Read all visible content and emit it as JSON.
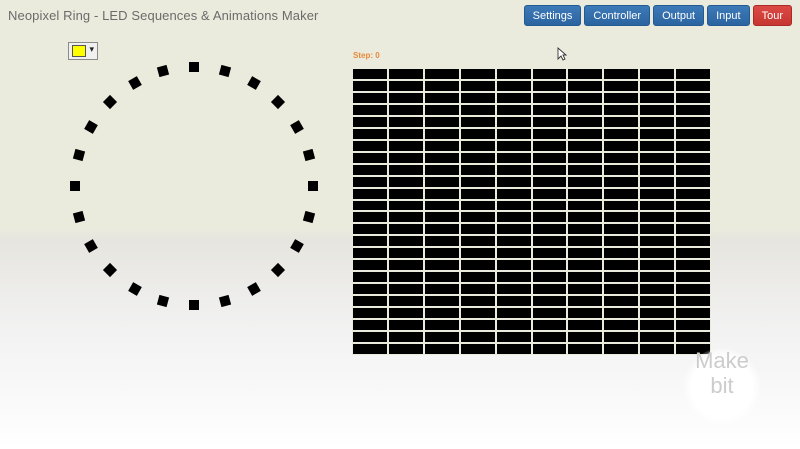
{
  "header": {
    "title": "Neopixel Ring - LED Sequences & Animations Maker"
  },
  "nav": [
    {
      "label": "Settings",
      "name": "settings-button"
    },
    {
      "label": "Controller",
      "name": "controller-button"
    },
    {
      "label": "Output",
      "name": "output-button"
    },
    {
      "label": "Input",
      "name": "input-button"
    },
    {
      "label": "Tour",
      "name": "tour-button"
    }
  ],
  "colors": {
    "selected": "#ffff00",
    "led_off": "#000000",
    "accent": "#2b64a0",
    "danger": "#c63632",
    "step": "#e8893a"
  },
  "picker": {
    "icon": "chevron-down-icon"
  },
  "ring": {
    "led_count": 24
  },
  "sequence": {
    "step_text": "Step: 0",
    "columns": 10,
    "rows": 24
  },
  "logo": {
    "line1": "Make",
    "line2": "bit"
  }
}
